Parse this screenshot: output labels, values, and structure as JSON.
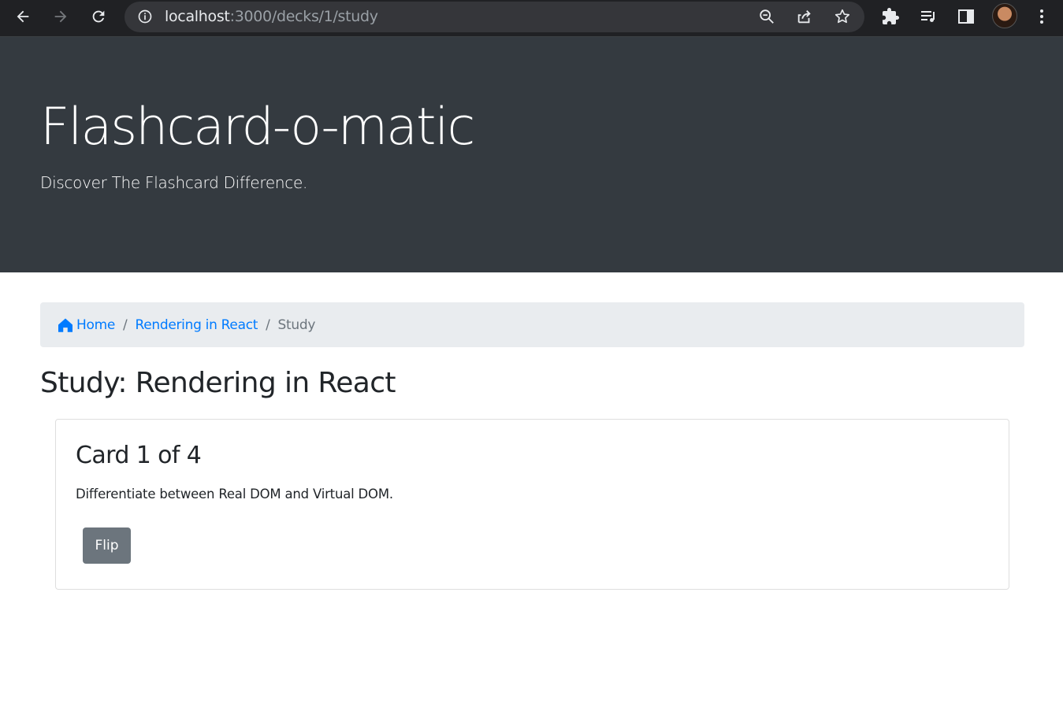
{
  "browser": {
    "url_host": "localhost",
    "url_path": ":3000/decks/1/study"
  },
  "jumbotron": {
    "title": "Flashcard-o-matic",
    "subtitle": "Discover The Flashcard Difference."
  },
  "breadcrumb": {
    "home": "Home",
    "deck": "Rendering in React",
    "current": "Study",
    "separator": "/",
    "link_color": "#007bff"
  },
  "page": {
    "title": "Study: Rendering in React"
  },
  "card": {
    "title": "Card 1 of 4",
    "text": "Differentiate between Real DOM and Virtual DOM.",
    "flip_label": "Flip"
  },
  "colors": {
    "jumbotron_bg": "#343a40",
    "breadcrumb_bg": "#e9ecef",
    "button_bg": "#6c757d"
  }
}
